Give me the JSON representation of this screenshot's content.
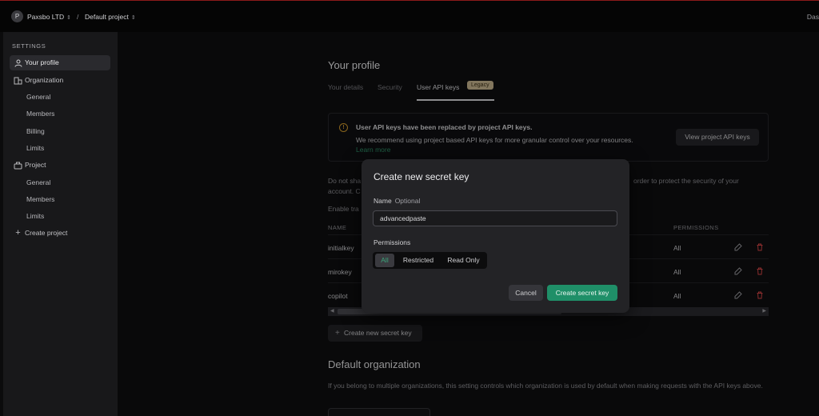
{
  "topbar": {
    "org_avatar": "P",
    "org_name": "Paxsbo LTD",
    "separator": "/",
    "project_name": "Default project",
    "right_text": "Das"
  },
  "sidebar": {
    "heading": "SETTINGS",
    "your_profile": "Your profile",
    "organization": "Organization",
    "org_items": [
      "General",
      "Members",
      "Billing",
      "Limits"
    ],
    "project": "Project",
    "project_items": [
      "General",
      "Members",
      "Limits"
    ],
    "create_project": "Create project"
  },
  "page": {
    "title": "Your profile",
    "tabs": [
      "Your details",
      "Security",
      "User API keys"
    ],
    "legacy_badge": "Legacy",
    "notice": {
      "title": "User API keys have been replaced by project API keys.",
      "body": "We recommend using project based API keys for more granular control over your resources.",
      "link": "Learn more",
      "button": "View project API keys"
    },
    "para_left": "Do not sha",
    "para_right": "order to protect the security of your",
    "para_left2": "account. C",
    "enable_text": "Enable tra",
    "table": {
      "col_name": "NAME",
      "col_permissions": "PERMISSIONS",
      "rows": [
        {
          "name": "initialkey",
          "permissions": "All"
        },
        {
          "name": "mirokey",
          "permissions": "All"
        },
        {
          "name": "copilot",
          "permissions": "All"
        }
      ]
    },
    "create_button": "Create new secret key",
    "default_org_title": "Default organization",
    "default_org_text": "If you belong to multiple organizations, this setting controls which organization is used by default when making requests with the API keys above."
  },
  "modal": {
    "title": "Create new secret key",
    "name_label": "Name",
    "name_optional": "Optional",
    "name_value": "advancedpaste",
    "permissions_label": "Permissions",
    "permission_options": [
      "All",
      "Restricted",
      "Read Only"
    ],
    "selected_permission": "All",
    "cancel": "Cancel",
    "submit": "Create secret key"
  },
  "colors": {
    "accent_green": "#1f8f68",
    "legacy_badge": "#c8b58f",
    "warning": "#d29a2d",
    "delete_red": "#d64545"
  }
}
